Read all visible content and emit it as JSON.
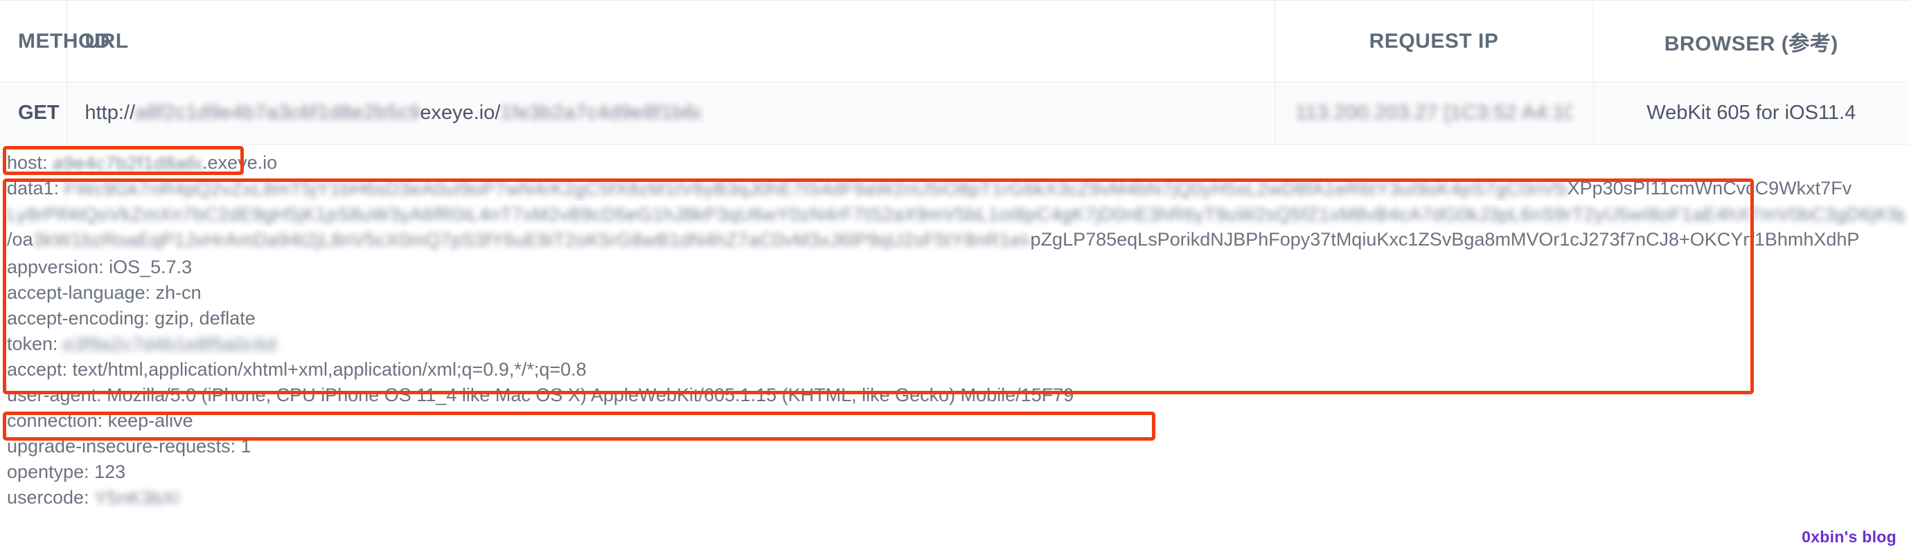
{
  "table": {
    "columns": [
      {
        "key": "method",
        "label": "METHOD",
        "align": "left"
      },
      {
        "key": "url",
        "label": "URL",
        "align": "left"
      },
      {
        "key": "ip",
        "label": "REQUEST IP",
        "align": "center"
      },
      {
        "key": "browser",
        "label": "BROWSER (参考)",
        "align": "center"
      }
    ],
    "rows": [
      {
        "method": "GET",
        "url_prefix": "http://",
        "url_redacted_host": "a8f2c1d9e4b7a3c6f1d8e2b5c9",
        "url_domain": "exeye.io/",
        "url_redacted_path": "1fe3b2a7c4d9e8f1b6c",
        "ip_redacted": "113.200.203.27 [1C3:52 A4:109]",
        "browser": "WebKit 605 for iOS11.4"
      }
    ]
  },
  "headers": {
    "lines": [
      {
        "name": "host",
        "segments": [
          {
            "type": "text",
            "value": "host: "
          },
          {
            "type": "redacted",
            "value": "a9e4c7b2f1d8a6c3e9b5d2f7c4a1e8"
          },
          {
            "type": "text",
            "value": ".exeye.io"
          }
        ]
      },
      {
        "name": "data1",
        "segments": [
          {
            "type": "text",
            "value": "data1: "
          },
          {
            "type": "redacted",
            "value": "FWc9Gk7nR4pQ2vZxL8mT5jY1bH6sD3eA0uI9oP7wN4rK2gC5fX8zM1tV6yB3qJ0hE7lS4dF9aW2nU5iO8pT1rG6kX3cZ9vM4bN7jQ0yH5sL2wD8fA1eR6tY3uI9oK4pS7gC0nV5mB2xZ8jL1qW6rT4yH9dF3aE7sN0iU5oP2kG8cX1vM6bJ4zQ9wR3tY7lD0fS5aH2nE8iK1pO6gC4xV9mZ3bT7jL0qW5rY8dF2aS6"
          },
          {
            "type": "plain",
            "value": "XPp30sPI11cm"
          },
          {
            "type": "plain_overflow",
            "value": "WnCvcC9Wkxt7Fv"
          }
        ]
      },
      {
        "name": "data1-continuation",
        "segments": [
          {
            "type": "redacted",
            "value": "Ly8rPlf4tQoVkZmXn7bC2dE9gH5jK1pS8uW3yA6fR0iL4nT7xM2vB9cD5eG1hJ8kP3qU6wY0zN4rF7tS2aX9mV5bL1oI8pC4gK7jD0nE3hR6yT9uW2sQ5fZ1xM8vB4cA7dG0kJ3pL6nS9rT2yU5wI8oF1aE4hX7mV0bC3gD6jK9pQ2sN5tR8yL1uW4zA7fI0oE3hM6xV9bG2cD5kJ8pT1nS4rY7wU0zQ3aF6iL9oX2mE5hB8vC1gK4dJ7p"
          },
          {
            "type": "text",
            "value": "/oa"
          },
          {
            "type": "redacted",
            "value": "3kW1bzRoaEqP1JxHrAmDa94t2jL8nV5cX0mQ7pS3fY6uE9iT2oK5rG8wB1dN4hZ7aC0vM3xJ6lP9qU2sF5tY8nR1eI4oW7gD0kB3zV6cH9mA2pX5jQ8lT1yS4"
          },
          {
            "type": "plain",
            "value": "pZgLP785eqLsPorikdNJBPhFopy37tMqiuKxc1ZSvBga8mMVOr1cJ273f7nCJ8+O"
          },
          {
            "type": "plain_overflow",
            "value": "KCYrf1BhmhXdhP"
          }
        ]
      },
      {
        "name": "appversion",
        "segments": [
          {
            "type": "text",
            "value": "appversion: iOS_5.7.3"
          }
        ]
      },
      {
        "name": "accept-language",
        "segments": [
          {
            "type": "text",
            "value": "accept-language: zh-cn"
          }
        ]
      },
      {
        "name": "accept-encoding",
        "segments": [
          {
            "type": "text",
            "value": "accept-encoding: gzip, deflate"
          }
        ]
      },
      {
        "name": "token",
        "segments": [
          {
            "type": "text",
            "value": "token: "
          },
          {
            "type": "redacted",
            "value": "e3f9a2c7d4b1e8f5a0c6d3b9e2f7a4c1d8b5e0f3a6c9d2b7e4f1a8c5d0b3!!!!"
          }
        ]
      },
      {
        "name": "accept",
        "segments": [
          {
            "type": "text",
            "value": "accept: text/html,application/xhtml+xml,application/xml;q=0.9,*/*;q=0.8"
          }
        ]
      },
      {
        "name": "user-agent",
        "segments": [
          {
            "type": "text",
            "value": "user-agent: Mozilla/5.0 (iPhone; CPU iPhone OS 11_4 like Mac OS X) AppleWebKit/605.1.15 (KHTML, like Gecko) Mobile/15F79"
          }
        ]
      },
      {
        "name": "connection",
        "segments": [
          {
            "type": "text",
            "value": "connection: keep-alive"
          }
        ]
      },
      {
        "name": "upgrade-insecure-requests",
        "segments": [
          {
            "type": "text",
            "value": "upgrade-insecure-requests: 1"
          }
        ]
      },
      {
        "name": "opentype",
        "segments": [
          {
            "type": "text",
            "value": "opentype: 123"
          }
        ]
      },
      {
        "name": "usercode",
        "segments": [
          {
            "type": "text",
            "value": "usercode: "
          },
          {
            "type": "redacted",
            "value": "Y5nK3bX8Lc2W4q"
          }
        ]
      }
    ]
  },
  "annotations": {
    "color": "#f03c11",
    "boxes": [
      {
        "name": "host-highlight",
        "target": "host"
      },
      {
        "name": "payload-highlight",
        "target": "data1-through-token"
      },
      {
        "name": "user-agent-highlight",
        "target": "user-agent"
      }
    ]
  },
  "watermark": {
    "text": "0xbin's blog",
    "color": "#6a2fd4"
  }
}
